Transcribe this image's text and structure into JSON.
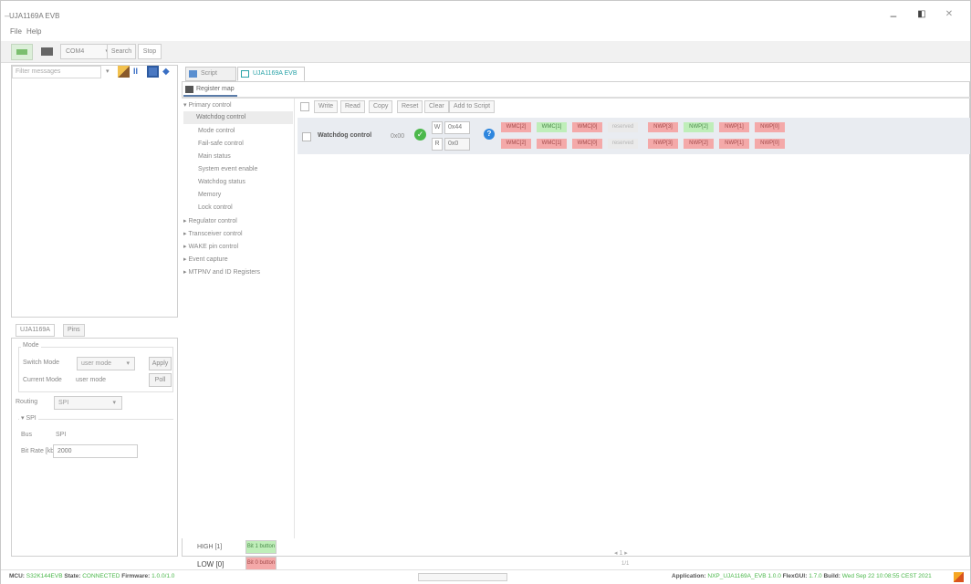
{
  "app": {
    "title": "UJA1169A EVB",
    "window_controls": {
      "minimize": "–",
      "maximize": "◧",
      "close": "✕"
    }
  },
  "menu": [
    "File",
    "Help"
  ],
  "toolbar": {
    "port": "COM4",
    "search_label": "Search",
    "stop_label": "Stop"
  },
  "left_panel": {
    "filter_placeholder": "Filter messages",
    "tabs": [
      "UJA1169A",
      "Pins"
    ],
    "mode": {
      "group_label": "Mode",
      "switch_label": "Switch Mode",
      "switch_value": "user mode",
      "apply_label": "Apply",
      "current_label": "Current Mode",
      "current_value": "user mode",
      "poll_label": "Poll"
    },
    "routing_label": "Routing",
    "routing_value": "SPI",
    "spi": {
      "group_label": "SPI",
      "bus_label": "Bus",
      "bus_value": "SPI",
      "bitrate_label": "Bit Rate [kbit/s]",
      "bitrate_value": "2000"
    }
  },
  "doc_tabs": [
    {
      "label": "Script editor",
      "active": false
    },
    {
      "label": "UJA1169A EVB",
      "active": true
    }
  ],
  "subtab": "Register map",
  "tree": [
    {
      "label": "▾ Primary control",
      "indent": 0,
      "selected": false
    },
    {
      "label": "Watchdog control",
      "indent": 1,
      "selected": true
    },
    {
      "label": "Mode control",
      "indent": 1,
      "selected": false
    },
    {
      "label": "Fail-safe control",
      "indent": 1,
      "selected": false
    },
    {
      "label": "Main status",
      "indent": 1,
      "selected": false
    },
    {
      "label": "System event enable",
      "indent": 1,
      "selected": false
    },
    {
      "label": "Watchdog status",
      "indent": 1,
      "selected": false
    },
    {
      "label": "Memory",
      "indent": 1,
      "selected": false
    },
    {
      "label": "Lock control",
      "indent": 1,
      "selected": false
    },
    {
      "label": "▸ Regulator control",
      "indent": 0,
      "selected": false
    },
    {
      "label": "▸ Transceiver control",
      "indent": 0,
      "selected": false
    },
    {
      "label": "▸ WAKE pin control",
      "indent": 0,
      "selected": false
    },
    {
      "label": "▸ Event capture",
      "indent": 0,
      "selected": false
    },
    {
      "label": "▸ MTPNV and ID Registers",
      "indent": 0,
      "selected": false
    }
  ],
  "register_toolbar": [
    "Write",
    "Read",
    "Copy",
    "Reset",
    "Clear",
    "Add to Script"
  ],
  "register": {
    "name": "Watchdog control",
    "address": "0x00",
    "write_label": "W",
    "read_label": "R",
    "write_value": "0x44",
    "read_value": "0x0",
    "write_bits": [
      {
        "label": "WMC[2]",
        "state": "red"
      },
      {
        "label": "WMC[1]",
        "state": "green"
      },
      {
        "label": "WMC[0]",
        "state": "red"
      },
      {
        "label": "reserved",
        "state": "grey"
      },
      {
        "label": "NWP[3]",
        "state": "red"
      },
      {
        "label": "NWP[2]",
        "state": "green"
      },
      {
        "label": "NWP[1]",
        "state": "red"
      },
      {
        "label": "NWP[0]",
        "state": "red"
      }
    ],
    "read_bits": [
      {
        "label": "WMC[2]",
        "state": "red"
      },
      {
        "label": "WMC[1]",
        "state": "red"
      },
      {
        "label": "WMC[0]",
        "state": "red"
      },
      {
        "label": "reserved",
        "state": "grey"
      },
      {
        "label": "NWP[3]",
        "state": "red"
      },
      {
        "label": "NWP[2]",
        "state": "red"
      },
      {
        "label": "NWP[1]",
        "state": "red"
      },
      {
        "label": "NWP[0]",
        "state": "red"
      }
    ]
  },
  "pins": {
    "high_label": "HIGH [1]",
    "high_button": "Bit 1 button",
    "low_label": "LOW [0]",
    "low_button": "Bit 0 button"
  },
  "pager": {
    "controls": "◂ 1 ▸",
    "page": "1/1"
  },
  "status": {
    "mcu_label": "MCU:",
    "mcu_value": "S32K144EVB",
    "state_label": "State:",
    "state_value": "CONNECTED",
    "firmware_label": "Firmware:",
    "firmware_value": "1.0.0/1.0",
    "app_label": "Application:",
    "app_value": "NXP_UJA1169A_EVB 1.0.0",
    "flex_label": "FlexGUI:",
    "flex_value": "1.7.0",
    "build_label": "Build:",
    "build_value": "Wed Sep 22 10:08:55 CEST 2021"
  },
  "colors": {
    "accent": "#2aa3a8",
    "bit_red": "#f4a9a9",
    "bit_green": "#bfeeb9",
    "bit_grey": "#eaeaea",
    "status_green": "#4cb84c",
    "info_blue": "#2e86de"
  }
}
